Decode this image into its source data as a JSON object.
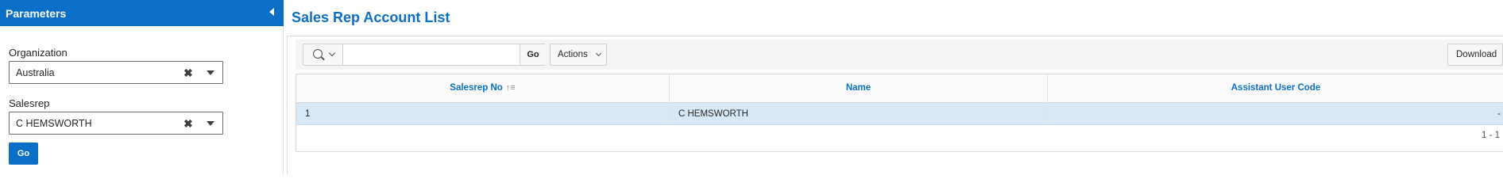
{
  "parameters_panel": {
    "title": "Parameters",
    "organization": {
      "label": "Organization",
      "value": "Australia"
    },
    "salesrep": {
      "label": "Salesrep",
      "value": "C HEMSWORTH"
    },
    "go_label": "Go"
  },
  "main": {
    "title": "Sales Rep Account List",
    "toolbar": {
      "search_placeholder": "",
      "go_label": "Go",
      "actions_label": "Actions",
      "download_label": "Download"
    },
    "table": {
      "columns": [
        {
          "label": "Salesrep No",
          "sorted": "ascending"
        },
        {
          "label": "Name"
        },
        {
          "label": "Assistant User Code"
        }
      ],
      "rows": [
        {
          "salesrep_no": "1",
          "name": "C HEMSWORTH",
          "assistant_user_code": "-"
        }
      ],
      "pagination": "1 - 1"
    }
  },
  "colors": {
    "accent": "#0b6fc7",
    "row_highlight": "#d7e8f7"
  }
}
